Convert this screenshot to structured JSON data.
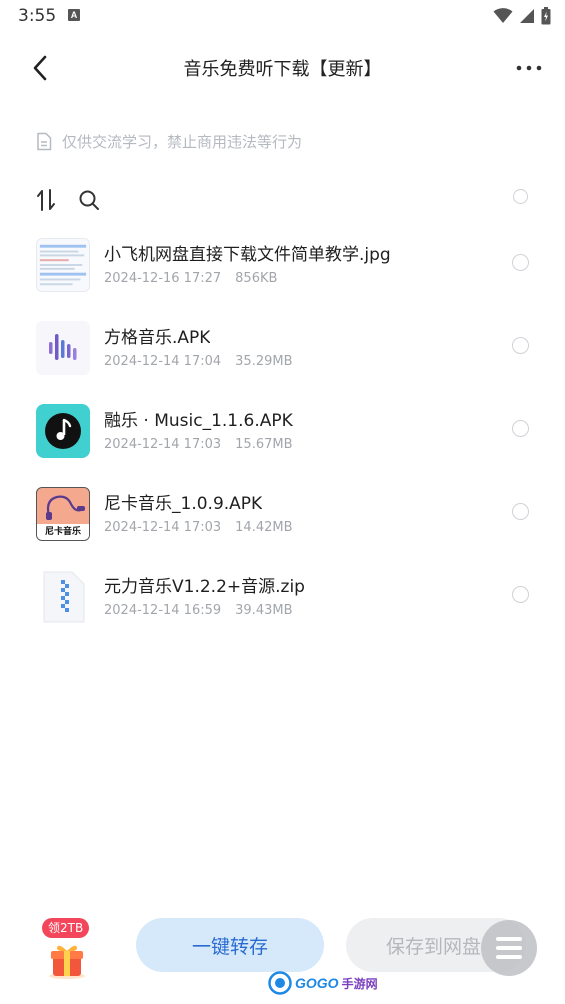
{
  "status_bar": {
    "time": "3:55",
    "notification_icon": "A"
  },
  "header": {
    "title": "音乐免费听下载【更新】",
    "back_icon": "chevron-left-icon",
    "more_icon": "more-horizontal-icon"
  },
  "notice": {
    "text": "仅供交流学习，禁止商用违法等行为",
    "icon": "document-icon"
  },
  "toolbar": {
    "sort_icon": "sort-icon",
    "search_icon": "search-icon"
  },
  "files": [
    {
      "name": "小飞机网盘直接下载文件简单教学.jpg",
      "date": "2024-12-16 17:27",
      "size": "856KB",
      "thumb": "image-thumbnail"
    },
    {
      "name": "方格音乐.APK",
      "date": "2024-12-14 17:04",
      "size": "35.29MB",
      "thumb": "soundwave-app-icon"
    },
    {
      "name": "融乐 · Music_1.1.6.APK",
      "date": "2024-12-14 17:03",
      "size": "15.67MB",
      "thumb": "music-note-app-icon"
    },
    {
      "name": "尼卡音乐_1.0.9.APK",
      "date": "2024-12-14 17:03",
      "size": "14.42MB",
      "thumb": "nika-music-app-icon",
      "thumb_label": "尼卡音乐"
    },
    {
      "name": "元力音乐V1.2.2+音源.zip",
      "date": "2024-12-14 16:59",
      "size": "39.43MB",
      "thumb": "zip-file-icon"
    }
  ],
  "bottom": {
    "reward_badge": "领2TB",
    "transfer_label": "一键转存",
    "save_label": "保存到网盘",
    "watermark_brand": "GOGO",
    "watermark_suffix": "手游网"
  },
  "colors": {
    "accent_blue": "#2a6bd0",
    "transfer_bg": "#d6e9fb",
    "badge_red": "#f4465a",
    "teal_app": "#3fd0cf"
  }
}
